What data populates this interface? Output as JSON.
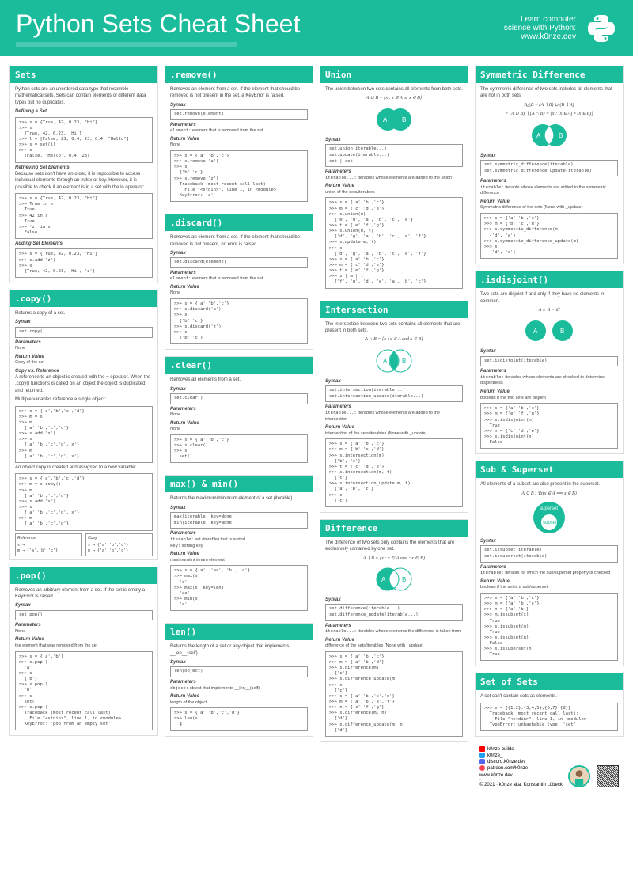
{
  "header": {
    "title": "Python Sets Cheat Sheet",
    "learn": "Learn computer\nscience with Python:",
    "link": "www.k0nze.dev"
  },
  "sets": {
    "title": "Sets",
    "intro": "Python sets are an unordered data type that resemble mathematical sets. Sets can contain elements of different data types but no duplicates.",
    "defining": "Defining a Set",
    "code1": ">>> s = {True, 42, 0.23, \"Hi\"}\n>>> s\n  {True, 42, 0.23, 'Hi'}\n>>> l = [False, 23, 0.4, 23, 0.4, \"Hello\"]\n>>> s = set(l)\n>>> s\n  {False, 'Hello', 0.4, 23}",
    "retrieving": "Retrieving Set Elements",
    "retrieving_desc": "Because sets don't have an order, it is impossible to access individual elements through an index or key. However, it is possible to check if an element is in a set with the in operator:",
    "code2": ">>> s = {True, 42, 0.23, \"Hi\"}\n>>> True in s\n  True\n>>> 42 in s\n  True\n>>> 'z' in s\n  False",
    "adding": "Adding Set Elements",
    "code3": ">>> s = {True, 42, 0.23, \"Hi\"}\n>>> s.add('z')\n>>> s\n  {True, 42, 0.23, 'Hi', 'z'}"
  },
  "copy": {
    "title": ".copy()",
    "desc": "Returns a copy of a set.",
    "syntax": "set.copy()",
    "params_none": "None",
    "return": "Copy of the set",
    "cvr": "Copy vs. Reference",
    "cvr_desc": "A reference to an object is created with the = operator. When the .copy() functions is called on an object the object is duplicated and returned.",
    "mult_ref": "Multiple variables reference a single object:",
    "code1": ">>> s = {'a','b','c','d'}\n>>> m = s\n>>> m\n  {'a','b','c','d'}\n>>> s.add('x')\n>>> s\n  {'a','b','c','d','x'}\n>>> m\n  {'a','b','c','d','x'}",
    "obj_copy": "An object copy is created and assigned to a new variable:",
    "code2": ">>> s = {'a','b','c','d'}\n>>> m = s.copy()\n>>> m\n  {'a','b','c','d'}\n>>> s.add('x')\n>>> s\n  {'a','b','c','d','x'}\n>>> m\n  {'a','b','c','d'}",
    "ref_label": "Reference",
    "copy_label": "Copy"
  },
  "pop": {
    "title": ".pop()",
    "desc": "Removes an arbitrary element from a set. If the set is empty a KeyError is raised.",
    "syntax": "set.pop()",
    "params_none": "None",
    "return": "the element that was removed from the set",
    "code": ">>> s = {'a','b'}\n>>> s.pop()\n  'a'\n>>> s\n  {'b'}\n>>> s.pop()\n  'b'\n>>> s\n  set()\n>>> s.pop()\n  Traceback (most recent call last):\n    File \"<stdin>\", line 1, in <module>\n  KeyError: 'pop from an empty set'"
  },
  "remove": {
    "title": ".remove()",
    "desc": "Removes an element from a set. If the element that should be removed is not present in the set, a KeyError is raised.",
    "syntax": "set.remove(element)",
    "param_el": "element that is removed from the set",
    "return": "None",
    "code": ">>> s = {'a','b','c'}\n>>> s.remove('a')\n>>> s\n  {'b','c'}\n>>> s.remove('z')\n  Traceback (most recent call last):\n    File \"<stdin>\", line 1, in <module>\n  KeyError: 'z'"
  },
  "discard": {
    "title": ".discard()",
    "desc": "Removes an element from a set. If the element that should be removed is not present, no error is raised.",
    "syntax": "set.discard(element)",
    "param_el": "element that is removed from the set",
    "return": "None",
    "code": ">>> s = {'a','b','c'}\n>>> s.discard('a')\n>>> s\n  {'b','c'}\n>>> s.discard('z')\n>>> s\n  {'b','c'}"
  },
  "clear": {
    "title": ".clear()",
    "desc": "Removes all elements from a set.",
    "syntax": "set.clear()",
    "params_none": "None",
    "return": "None",
    "code": ">>> s = {'a','b','c'}\n>>> s.clear()\n>>> s\n  set()"
  },
  "maxmin": {
    "title": "max() & min()",
    "desc": "Returns the maximum/minimum element of a set (iterable).",
    "syntax": "max(iterable, key=None)\nmin(iterable, key=None)",
    "param_iter": "set (iterable) that is sorted",
    "param_key": "sorting key",
    "return": "maximum/minimum element",
    "code": ">>> s = {'a', 'aa', 'b', 'c'}\n>>> max(s)\n  'c'\n>>> max(s, key=len)\n  'aa'\n>>> min(s)\n  'a'"
  },
  "len": {
    "title": "len()",
    "desc": "Returns the length of a set or any object that implements __len__(self).",
    "syntax": "len(object)",
    "param_obj": "object that implements __len__(self)",
    "return": "length of the object",
    "code": ">>> s = {'a','b','c','d'}\n>>> len(s)\n  4"
  },
  "union": {
    "title": "Union",
    "desc": "The union between two sets contains all elements from both sets.",
    "math": "A ∪ B = {x : x ∈ A  or  x ∈ B}",
    "syntax": "set.union(iterable...)\nset.update(iterable...)\nset | set",
    "param_iter": "iterables whose elements are added to the union",
    "return": "union of the sets/iterables",
    "code": ">>> s = {'a','b','c'}\n>>> m = {'c','d','e'}\n>>> s.union(m)\n  {'e', 'd', 'a', 'b', 'c', 'e'}\n>>> t = {'e','f','g'}\n>>> s.union(m, t)\n  {'d', 'g', 'a', 'b', 'c', 'e', 'f'}\n>>> s.update(m, t)\n>>> s\n  {'d', 'g', 'a', 'b', 'c', 'e', 'f'}\n>>> s = {'a','b','c'}\n>>> m = {'c','d','e'}\n>>> t = {'e','f','g'}\n>>> s | m | t\n  {'f', 'g', 'd', 'e', 'a', 'b', 'c'}"
  },
  "intersection": {
    "title": "Intersection",
    "desc": "The intersection between two sets contains all elements that are present in both sets.",
    "math": "A ∩ B = {x : x ∈ A  and  x ∈ B}",
    "syntax": "set.intersection(iterable...)\nset.intersection_update(iterable...)",
    "param_iter": "iterables whose elements are added to the intersection",
    "return": "intersection of the sets/iterables (None with _update)",
    "code": ">>> s = {'a','b','c'}\n>>> m = {'b','c','d'}\n>>> s.intersection(m)\n  {'b', 'c'}\n>>> t = {'c','d','e'}\n>>> s.intersection(m, t)\n  {'c'}\n>>> s.intersection_update(m, t)\n  {'a', 'b', 'c'}\n>>> s\n  {'c'}"
  },
  "difference": {
    "title": "Difference",
    "desc": "The difference of two sets only contains the elements that are exclusively contained by one set.",
    "math": "A ∖ B = {x : x ∈ A  and  ¬x ∈ B}",
    "syntax": "set.difference(iterable...)\nset.difference_update(iterable...)",
    "param_iter": "iterables whose elements the difference is taken from",
    "return": "difference of the sets/iterables (None with _update)",
    "code": ">>> s = {'a','b','c'}\n>>> m = {'a','b','d'}\n>>> s.difference(m)\n  {'c'}\n>>> s.difference_update(m)\n>>> s\n  {'c'}\n>>> s = {'a','b','c','d'}\n>>> m = {'a','b','e','f'}\n>>> n = {'c','f','g'}\n>>> s.difference(m, n)\n  {'d'}\n>>> s.difference_update(m, n)\n  {'d'}"
  },
  "symdiff": {
    "title": "Symmetric Difference",
    "desc": "The symmetric difference of two sets includes all elements that are not in both sets.",
    "math1": "A△B = (A ∖ B) ∪ (B ∖ A)",
    "math2": "= (A ∪ B) ∖ (A ∩ B) = {x : (x ∈ A) ≠ (x ∈ B)}",
    "syntax": "set.symmetric_difference(iterable)\nset.symmetric_difference_update(iterable)",
    "param_iter": "iterable whose elements are added to the symmetric difference",
    "return": "Symmetric difference of the sets (None with _update)",
    "code": ">>> s = {'a','b','c'}\n>>> m = {'b','c','d'}\n>>> s.symmetric_difference(m)\n  {'d', 'a'}\n>>> s.symmetric_difference_update(m)\n>>> s\n  {'d', 'a'}"
  },
  "isdisjoint": {
    "title": ".isdisjoint()",
    "desc": "Two sets are disjoint if and only if they have no elements in common.",
    "math": "A ∩ B = ∅",
    "syntax": "set.isdisjoint(iterable)",
    "param_iter": "iterables whose elements are checked to determine disjointness",
    "return": "boolean if the two sets are disjoint",
    "code": ">>> s = {'a','b','c'}\n>>> m = {'e','f','g'}\n>>> s.isdisjoint(m)\n  True\n>>> n = {'c','d','e'}\n>>> s.isdisjoint(n)\n  False"
  },
  "subset": {
    "title": "Sub & Superset",
    "desc": "All elements of a subset are also present in the superset.",
    "math": "A ⊆ B : ∀x(x ∈ A ⟹ x ∈ B)",
    "syntax": "set.issubset(iterable)\nset.issuperset(iterable)",
    "param_iter": "iterable for which the sub/superset property is checked",
    "return": "boolean if the set is a sub/superset",
    "code": ">>> s = {'a','b','c'}\n>>> m = {'a','b','c'}\n>>> n = {'a','b'}\n>>> m.issubset(s)\n  True\n>>> s.issubset(m)\n  True\n>>> s.issubset(n)\n  False\n>>> s.issuperset(n)\n  True"
  },
  "setofsets": {
    "title": "Set of Sets",
    "desc": "A set can't contain sets as elements.",
    "code": ">>> s = {{1,2},{3,4,5},{6,7},{8}}\n  Traceback (most recent call last):\n    File \"<stdin>\", line 1, in <module>\n  TypeError: unhashable type: 'set'"
  },
  "labels": {
    "syntax": "Syntax",
    "parameters": "Parameters",
    "return_value": "Return Value",
    "element": "element:",
    "iterable": "iterable:",
    "iterable_dots": "iterable...:",
    "key": "key:",
    "object": "object:",
    "superset": "superset",
    "subset": "subset"
  },
  "footer": {
    "socials": {
      "youtube": "k0nze builds",
      "twitter": "k0nze_",
      "discord": "discord.k0nze.dev",
      "patreon": "patreon.com/k0nze"
    },
    "url": "www.k0nze.dev",
    "copyright": "© 2021 · k0nze aka. Konstantin Lübeck"
  }
}
